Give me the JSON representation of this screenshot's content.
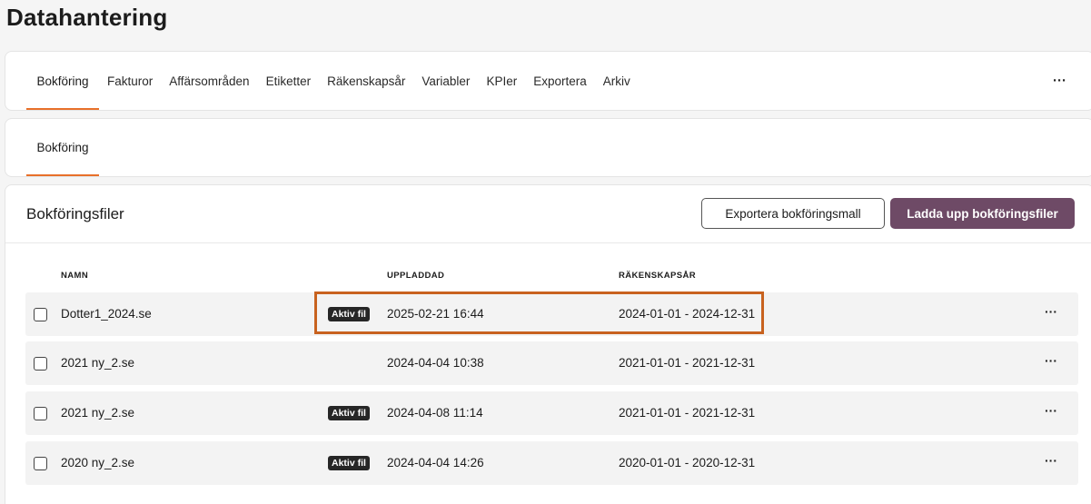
{
  "page": {
    "title": "Datahantering"
  },
  "tabs": {
    "items": [
      "Bokföring",
      "Fakturor",
      "Affärsområden",
      "Etiketter",
      "Räkenskapsår",
      "Variabler",
      "KPIer",
      "Exportera",
      "Arkiv"
    ],
    "active": "Bokföring",
    "more_label": "···"
  },
  "subtabs": {
    "items": [
      "Bokföring"
    ],
    "active": "Bokföring"
  },
  "section": {
    "title": "Bokföringsfiler",
    "export_button": "Exportera bokföringsmall",
    "upload_button": "Ladda upp bokföringsfiler"
  },
  "table": {
    "headers": {
      "name": "NAMN",
      "uploaded": "UPPLADDAD",
      "fiscal_year": "RÄKENSKAPSÅR"
    },
    "rows": [
      {
        "name": "Dotter1_2024.se",
        "badge": "Aktiv fil",
        "uploaded": "2025-02-21 16:44",
        "fiscal_year": "2024-01-01 - 2024-12-31",
        "more": "···"
      },
      {
        "name": "2021 ny_2.se",
        "badge": "",
        "uploaded": "2024-04-04 10:38",
        "fiscal_year": "2021-01-01 - 2021-12-31",
        "more": "···"
      },
      {
        "name": "2021 ny_2.se",
        "badge": "Aktiv fil",
        "uploaded": "2024-04-08 11:14",
        "fiscal_year": "2021-01-01 - 2021-12-31",
        "more": "···"
      },
      {
        "name": "2020 ny_2.se",
        "badge": "Aktiv fil",
        "uploaded": "2024-04-04 14:26",
        "fiscal_year": "2020-01-01 - 2020-12-31",
        "more": "···"
      }
    ]
  },
  "colors": {
    "accent": "#e8702a",
    "primary_button": "#6e4a66",
    "highlight": "#c8621f",
    "badge": "#262626"
  }
}
